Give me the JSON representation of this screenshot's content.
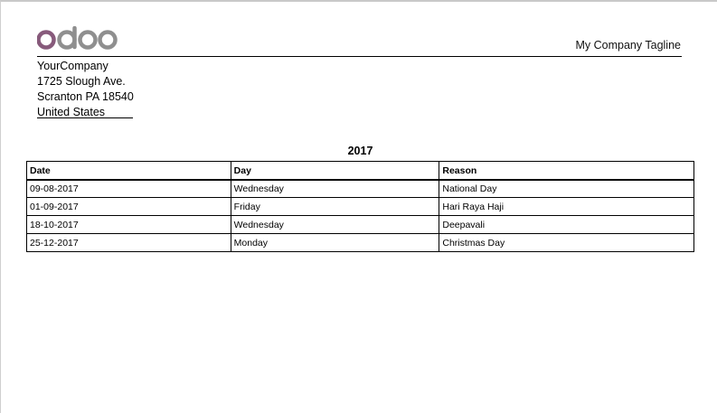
{
  "brand": {
    "logo_text": "odoo",
    "logo_color": "#875A7B",
    "logo_gray": "#8f8f8f"
  },
  "header": {
    "tagline": "My Company Tagline"
  },
  "company": {
    "name": "YourCompany",
    "street": "1725 Slough Ave.",
    "city_line": "Scranton PA 18540",
    "country": "United States"
  },
  "report": {
    "title": "2017",
    "columns": [
      "Date",
      "Day",
      "Reason"
    ],
    "rows": [
      {
        "date": "09-08-2017",
        "day": "Wednesday",
        "reason": "National Day"
      },
      {
        "date": "01-09-2017",
        "day": "Friday",
        "reason": "Hari Raya Haji"
      },
      {
        "date": "18-10-2017",
        "day": "Wednesday",
        "reason": "Deepavali"
      },
      {
        "date": "25-12-2017",
        "day": "Monday",
        "reason": "Christmas Day"
      }
    ]
  }
}
